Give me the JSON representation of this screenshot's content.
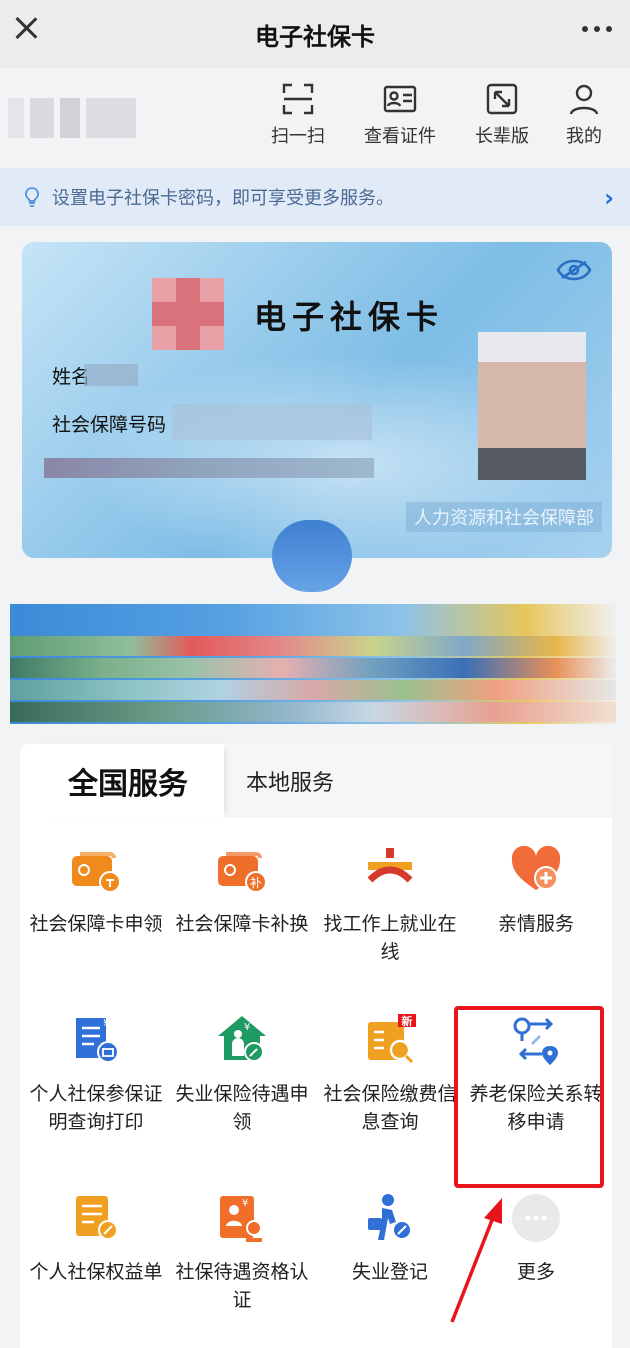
{
  "header": {
    "title": "电子社保卡"
  },
  "toolbar": {
    "tools": [
      {
        "label": "扫一扫",
        "icon": "scan-icon"
      },
      {
        "label": "查看证件",
        "icon": "id-card-icon"
      },
      {
        "label": "长辈版",
        "icon": "elder-mode-icon"
      },
      {
        "label": "我的",
        "icon": "user-icon"
      }
    ]
  },
  "notice": {
    "text": "设置电子社保卡密码，即可享受更多服务。",
    "icon": "lightbulb-icon"
  },
  "card": {
    "title": "电子社保卡",
    "name_label": "姓名",
    "id_label": "社会保障号码",
    "issuer": "人力资源和社会保障部"
  },
  "services": {
    "tabs": [
      {
        "label": "全国服务",
        "active": true
      },
      {
        "label": "本地服务",
        "active": false
      }
    ],
    "items": [
      {
        "label": "社会保障卡申领",
        "icon": "card-apply-icon"
      },
      {
        "label": "社会保障卡补换",
        "icon": "card-replace-icon"
      },
      {
        "label": "找工作上就业在线",
        "icon": "job-search-icon"
      },
      {
        "label": "亲情服务",
        "icon": "family-heart-icon"
      },
      {
        "label": "个人社保参保证明查询打印",
        "icon": "certificate-print-icon"
      },
      {
        "label": "失业保险待遇申领",
        "icon": "unemployment-benefit-icon"
      },
      {
        "label": "社会保险缴费信息查询",
        "icon": "payment-query-icon",
        "badge": "新"
      },
      {
        "label": "养老保险关系转移申请",
        "icon": "pension-transfer-icon"
      },
      {
        "label": "个人社保权益单",
        "icon": "rights-statement-icon"
      },
      {
        "label": "社保待遇资格认证",
        "icon": "qualification-auth-icon"
      },
      {
        "label": "失业登记",
        "icon": "unemployment-register-icon"
      },
      {
        "label": "更多",
        "icon": "more-icon"
      }
    ]
  },
  "colors": {
    "accent": "#1f6fd6",
    "orange": "#f08a1c",
    "highlight": "#e8141c"
  }
}
